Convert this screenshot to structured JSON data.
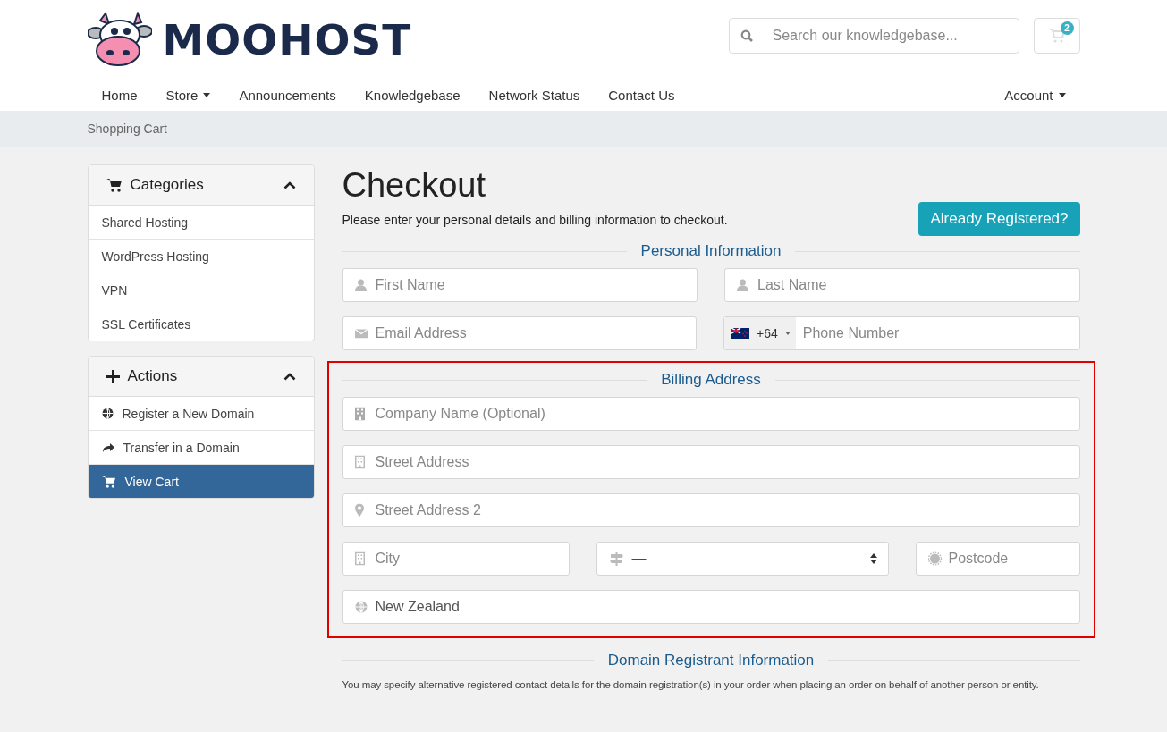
{
  "logo": {
    "text": "MOOHOST"
  },
  "search": {
    "placeholder": "Search our knowledgebase..."
  },
  "cart": {
    "count": "2"
  },
  "nav": {
    "items": [
      {
        "label": "Home",
        "dropdown": false
      },
      {
        "label": "Store",
        "dropdown": true
      },
      {
        "label": "Announcements",
        "dropdown": false
      },
      {
        "label": "Knowledgebase",
        "dropdown": false
      },
      {
        "label": "Network Status",
        "dropdown": false
      },
      {
        "label": "Contact Us",
        "dropdown": false
      }
    ],
    "account": {
      "label": "Account",
      "dropdown": true
    }
  },
  "breadcrumb": "Shopping Cart",
  "sidebar": [
    {
      "title": "Categories",
      "kind": "cart",
      "expanded": true,
      "items": [
        {
          "label": "Shared Hosting",
          "kind": "plain",
          "selected": false
        },
        {
          "label": "WordPress Hosting",
          "kind": "plain",
          "selected": false
        },
        {
          "label": "VPN",
          "kind": "plain",
          "selected": false
        },
        {
          "label": "SSL Certificates",
          "kind": "plain",
          "selected": false
        }
      ]
    },
    {
      "title": "Actions",
      "kind": "plus",
      "expanded": true,
      "items": [
        {
          "label": "Register a New Domain",
          "kind": "globe",
          "selected": false
        },
        {
          "label": "Transfer in a Domain",
          "kind": "share",
          "selected": false
        },
        {
          "label": "View Cart",
          "kind": "cart",
          "selected": true
        }
      ]
    }
  ],
  "checkout": {
    "title": "Checkout",
    "intro": "Please enter your personal details and billing information to checkout.",
    "button": "Already Registered?"
  },
  "sections": [
    {
      "title": "Personal Information",
      "highlighted": false,
      "rows": [
        [
          {
            "kind": "text",
            "placeholder": "First Name"
          },
          {
            "kind": "text",
            "placeholder": "Last Name"
          }
        ],
        [
          {
            "kind": "text",
            "placeholder": "Email Address"
          },
          {
            "kind": "phone",
            "code": "+64",
            "placeholder": "Phone Number"
          }
        ]
      ]
    },
    {
      "title": "Billing Address",
      "highlighted": true,
      "rows": [
        [
          {
            "kind": "text",
            "placeholder": "Company Name (Optional)"
          }
        ],
        [
          {
            "kind": "text",
            "placeholder": "Street Address"
          }
        ],
        [
          {
            "kind": "text",
            "placeholder": "Street Address 2"
          }
        ],
        [
          {
            "kind": "text",
            "placeholder": "City"
          },
          {
            "kind": "select",
            "value": "—"
          },
          {
            "kind": "text",
            "placeholder": "Postcode"
          }
        ],
        [
          {
            "kind": "text",
            "value": "New Zealand"
          }
        ]
      ]
    },
    {
      "title": "Domain Registrant Information",
      "highlighted": false,
      "note": "You may specify alternative registered contact details for the domain registration(s) in your order when placing an order on behalf of another person or entity."
    }
  ]
}
